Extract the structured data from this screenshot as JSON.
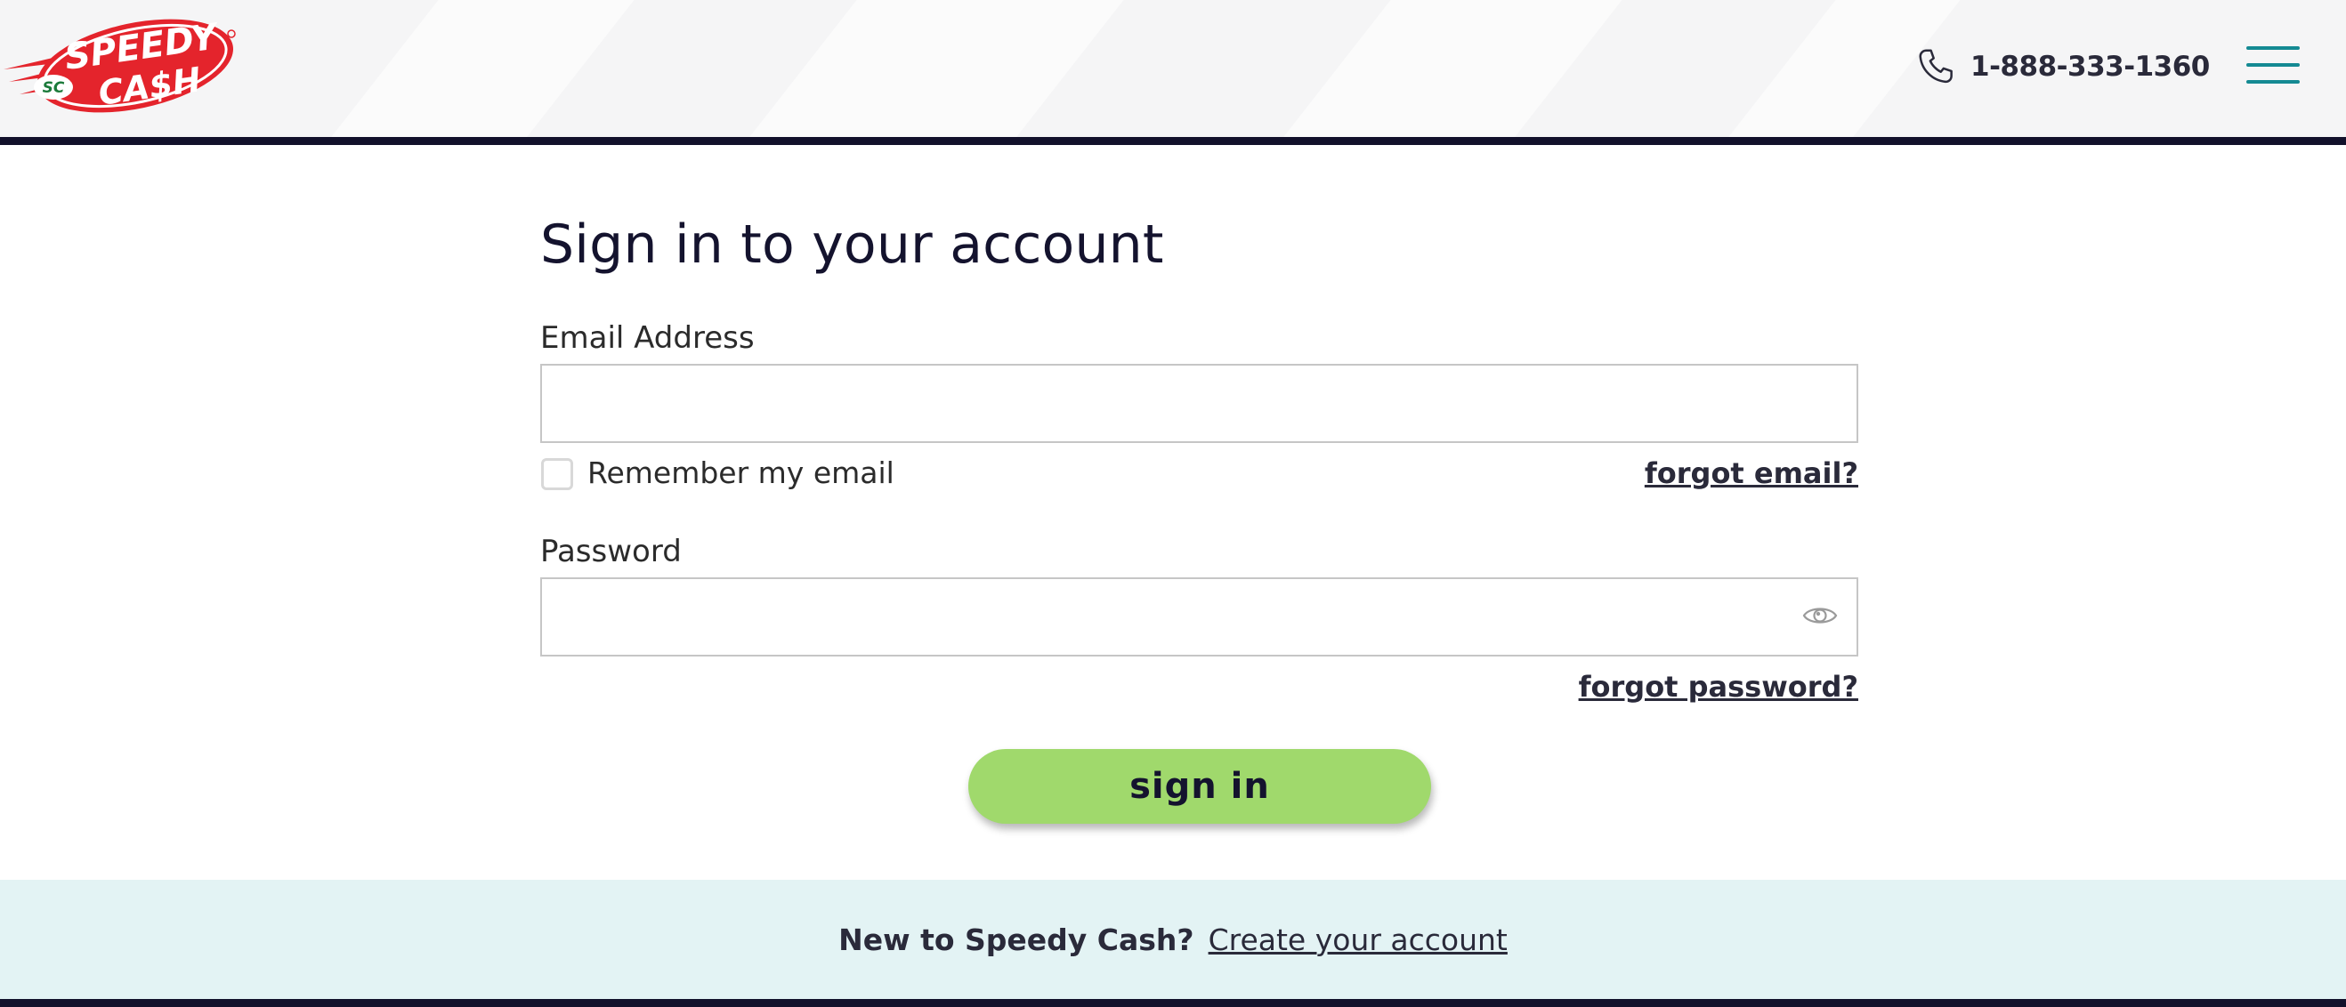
{
  "header": {
    "logo_text_top": "SPEEDY",
    "logo_text_bottom": "CA$H",
    "logo_badge": "SC",
    "phone_icon": "phone-icon",
    "phone": "1-888-333-1360",
    "menu_icon": "hamburger-menu-icon"
  },
  "colors": {
    "brand_red": "#e4242c",
    "brand_green": "#1b7a3a",
    "accent_teal": "#148a93",
    "button_green": "#a0d96c",
    "navy": "#12112b",
    "band_bg": "#e3f3f4"
  },
  "form": {
    "title": "Sign in to your account",
    "email_label": "Email Address",
    "email_value": "",
    "remember_label": "Remember my email",
    "remember_checked": false,
    "forgot_email": "forgot email?",
    "password_label": "Password",
    "password_value": "",
    "password_toggle_icon": "eye-icon",
    "forgot_password": "forgot password?",
    "submit_label": "sign in"
  },
  "signup": {
    "question": "New to Speedy Cash?",
    "link": "Create your account"
  }
}
